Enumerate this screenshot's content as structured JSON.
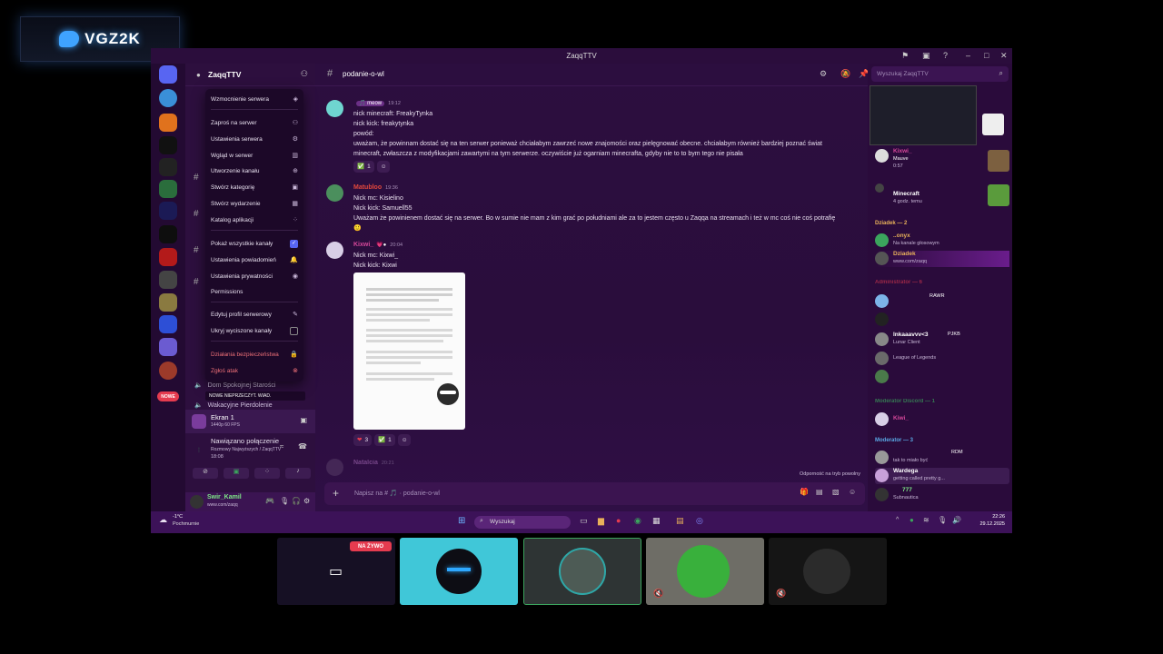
{
  "brand": {
    "logo_text": "VGZ2K"
  },
  "window": {
    "title": "ZaqqTTV"
  },
  "server": {
    "name": "ZaqqTTV"
  },
  "channel": {
    "name": "podanie-o-wl",
    "composer_placeholder": "Napisz na # 🎵 · podanie-o-wl",
    "search_placeholder": "Wyszukaj ZaqqTTV"
  },
  "menu": {
    "items": [
      {
        "label": "Wzmocnienie serwera",
        "icon": "boost-icon"
      },
      {
        "label": "Zaproś na serwer",
        "icon": "invite-icon"
      },
      {
        "label": "Ustawienia serwera",
        "icon": "gear-icon"
      },
      {
        "label": "Wgląd w serwer",
        "icon": "insights-icon"
      },
      {
        "label": "Utworzenie kanału",
        "icon": "plus-circle-icon"
      },
      {
        "label": "Stwórz kategorię",
        "icon": "folder-plus-icon"
      },
      {
        "label": "Stwórz wydarzenie",
        "icon": "calendar-icon"
      },
      {
        "label": "Katalog aplikacji",
        "icon": "apps-icon"
      },
      {
        "label": "Pokaż wszystkie kanały",
        "icon": "checkbox-checked-icon"
      },
      {
        "label": "Ustawienia powiadomień",
        "icon": "bell-icon"
      },
      {
        "label": "Ustawienia prywatności",
        "icon": "shield-icon"
      },
      {
        "label": "Permissions",
        "icon": ""
      },
      {
        "label": "Edytuj profil serwerowy",
        "icon": "pencil-icon"
      },
      {
        "label": "Ukryj wyciszone kanały",
        "icon": "checkbox-icon"
      },
      {
        "label": "Działania bezpieczeństwa",
        "icon": "lock-icon"
      },
      {
        "label": "Zgłoś atak",
        "icon": "alert-icon"
      }
    ]
  },
  "sidebar": {
    "voice_channels": [
      "Dom Spokojnej Starości",
      "Wakacyjne Pierdolenie"
    ],
    "new_badge": "NOWE",
    "new_unread": "NOWE NIEPRZECZYT. WIAD.",
    "stream": {
      "name": "Ekran 1",
      "sub": "1440p 60 FPS"
    },
    "connection": {
      "status": "Nawiązano połączenie",
      "channel": "Rozmowy Najwyższych / ZaqqTTV",
      "time": "18:08"
    },
    "user": {
      "name": "Swir_Kamil",
      "status": "www.com/zaqq"
    }
  },
  "messages": [
    {
      "author": "",
      "time": "19:12",
      "lines": [
        "nick minecraft: FreakyTynka",
        "nick kick: freakytynka",
        "powód:",
        "uważam, że powinnam dostać się na ten serwer ponieważ chciałabym zawrzeć nowe znajomości oraz pielęgnować obecne. chciałabym również bardziej poznać świat",
        "minecraft, zwłaszcza z modyfikacjami zawartymi na tym serwerze. oczywiście już ogarniam minecrafta, gdyby nie to to bym tego nie pisała"
      ],
      "reaction": "1"
    },
    {
      "author": "Matubloo",
      "time": "19:36",
      "lines": [
        "Nick mc: Kisielino",
        "Nick kick: Samuell55",
        "Uważam że powinienem dostać się na serwer.  Bo w sumie nie mam  z kim grać po południami ale za to jestem często u Zaqqa na streamach i też w mc coś nie coś potrafię"
      ]
    },
    {
      "author": "Kixwi_",
      "time": "20:04",
      "lines": [
        "Nick mc: Kixwi_",
        "Nick kick: Kixwi"
      ],
      "reactions": [
        "3",
        "1"
      ]
    },
    {
      "author": "Natalcia",
      "time": "20:21",
      "lines": []
    }
  ],
  "slowmode_note": "Odporność na tryb powolny",
  "members": {
    "activity": [
      {
        "name": "Kixwi_",
        "status": "Mauve",
        "sub": "0:57"
      },
      {
        "name": "Minecraft",
        "status": "4 godz. temu"
      }
    ],
    "sections": [
      {
        "title": "Dziadek — 2",
        "members": [
          {
            "name": "..onyx",
            "status": "Na kanale głosowym"
          },
          {
            "name": "Dziadek",
            "status": "www.com/zaqq"
          }
        ]
      },
      {
        "title": "Administrator — 6",
        "members": [
          {
            "name": "",
            "status": ""
          },
          {
            "name": "",
            "status": ""
          },
          {
            "name": "lnkaaavvv<3",
            "status": "Lunar Client"
          },
          {
            "name": "",
            "status": "League of Legends"
          },
          {
            "name": "",
            "status": ""
          }
        ]
      },
      {
        "title": "Moderator Discord — 1",
        "members": [
          {
            "name": "Kiwi_",
            "status": ""
          }
        ]
      },
      {
        "title": "Moderator — 3",
        "members": [
          {
            "name": "",
            "status": "tak to miało być"
          },
          {
            "name": "Wardega",
            "status": "getting called pretty g..."
          },
          {
            "name": "777",
            "status": "Subnautica"
          }
        ]
      }
    ],
    "tags": {
      "rawr": "RAWR",
      "pjkb": "PJKB",
      "rdm": "RDM"
    }
  },
  "taskbar": {
    "weather_temp": "-1°C",
    "weather_desc": "Pochmurnie",
    "search": "Wyszukaj",
    "time": "22:26",
    "date": "29.12.2025"
  },
  "tiles": {
    "live_badge": "NA ŻYWO"
  }
}
